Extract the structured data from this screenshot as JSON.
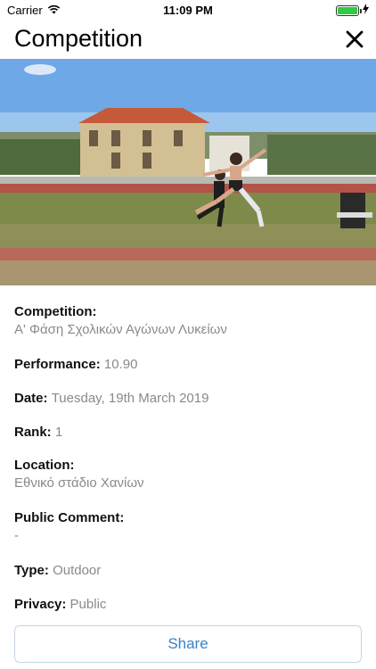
{
  "status_bar": {
    "carrier": "Carrier",
    "time": "11:09 PM",
    "battery_color": "#2ecc40"
  },
  "header": {
    "title": "Competition",
    "close_icon": "close-icon"
  },
  "details": {
    "competition_label": "Competition:",
    "competition_value": "Α' Φάση Σχολικών Αγώνων Λυκείων",
    "performance_label": "Performance:",
    "performance_value": "10.90",
    "date_label": "Date:",
    "date_value": "Tuesday, 19th March 2019",
    "rank_label": "Rank:",
    "rank_value": "1",
    "location_label": "Location:",
    "location_value": "Εθνικό στάδιο Χανίων",
    "comment_label": "Public Comment:",
    "comment_value": "-",
    "type_label": "Type:",
    "type_value": "Outdoor",
    "privacy_label": "Privacy:",
    "privacy_value": "Public"
  },
  "actions": {
    "share_label": "Share"
  },
  "colors": {
    "accent": "#3a7fc9",
    "value_text": "#8a8a8e"
  }
}
